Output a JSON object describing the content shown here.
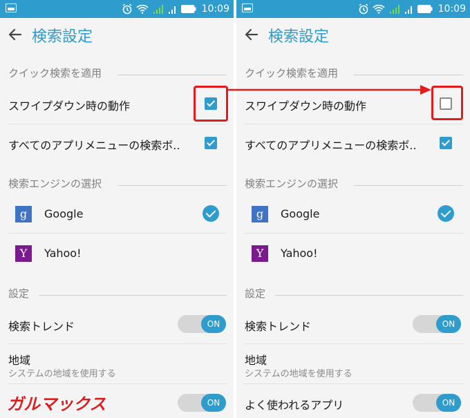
{
  "status": {
    "time": "10:09"
  },
  "screens": [
    {
      "title": "検索設定",
      "section_quick": "クイック検索を適用",
      "swipe_label": "スワイプダウン時の動作",
      "swipe_checked": true,
      "all_apps_label": "すべてのアプリメニューの検索ボ..",
      "all_apps_checked": true,
      "section_engine": "検索エンジンの選択",
      "engine_google": "Google",
      "engine_google_icon": "g",
      "engine_yahoo": "Yahoo!",
      "engine_yahoo_icon": "Y",
      "section_settings": "設定",
      "trend_label": "検索トレンド",
      "trend_toggle": "ON",
      "region_label": "地域",
      "region_sub": "システムの地域を使用する",
      "bottom_label": "",
      "bottom_toggle": "ON"
    },
    {
      "title": "検索設定",
      "section_quick": "クイック検索を適用",
      "swipe_label": "スワイプダウン時の動作",
      "swipe_checked": false,
      "all_apps_label": "すべてのアプリメニューの検索ボ..",
      "all_apps_checked": true,
      "section_engine": "検索エンジンの選択",
      "engine_google": "Google",
      "engine_google_icon": "g",
      "engine_yahoo": "Yahoo!",
      "engine_yahoo_icon": "Y",
      "section_settings": "設定",
      "trend_label": "検索トレンド",
      "trend_toggle": "ON",
      "region_label": "地域",
      "region_sub": "システムの地域を使用する",
      "bottom_label": "よく使われるアプリ",
      "bottom_toggle": "ON"
    }
  ],
  "watermark": {
    "text": "ガルマックス"
  },
  "colors": {
    "accent": "#2e9ccc",
    "highlight": "#e21c1c",
    "google": "#3f73c6",
    "yahoo": "#7b1a8e"
  }
}
